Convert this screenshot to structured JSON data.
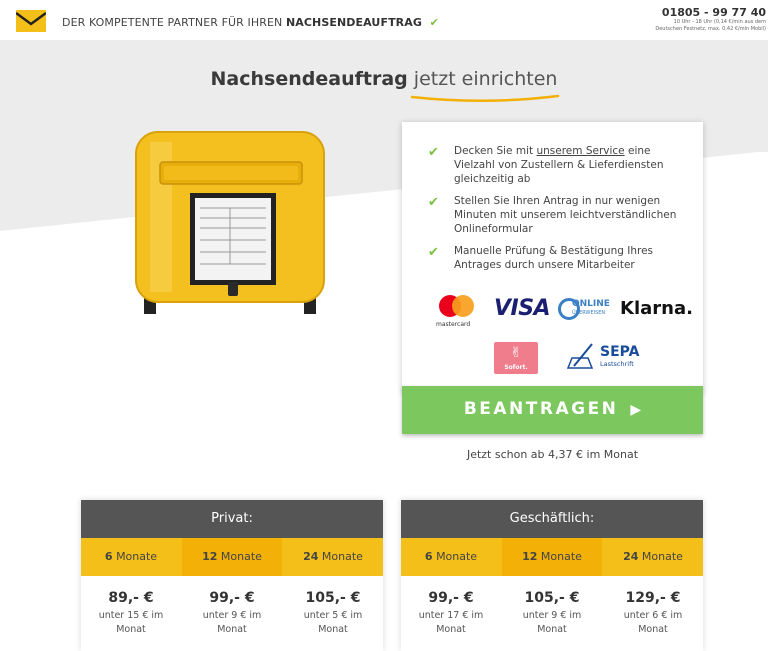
{
  "header": {
    "tagline_prefix": "DER KOMPETENTE PARTNER FÜR IHREN",
    "tagline_bold": "NACHSENDEAUFTRAG",
    "check_icon": "check-icon",
    "phone": "01805 - 99 77 40",
    "phone_note_line1": "10 Uhr - 18 Uhr (0,14 €/min aus dem",
    "phone_note_line2": "Deutschen Festnetz, max. 0,42 €/min Mobil)"
  },
  "hero": {
    "title_bold": "Nachsendeauftrag",
    "title_light": "jetzt einrichten"
  },
  "features": [
    {
      "before": "Decken Sie mit ",
      "link": "unserem Service",
      "after": " eine Vielzahl von Zustellern & Lieferdiensten gleichzeitig ab"
    },
    {
      "before": "Stellen Sie Ihren Antrag in nur wenigen Minuten mit unserem leichtverständlichen Onlineformular",
      "link": "",
      "after": ""
    },
    {
      "before": "Manuelle Prüfung & Bestätigung Ihres Antrages durch unsere Mitarbeiter",
      "link": "",
      "after": ""
    }
  ],
  "payments": {
    "mastercard": "mastercard",
    "visa": "VISA",
    "online_line1": "ONLINE",
    "online_line2": "ÜBERWEISEN",
    "klarna": "Klarna.",
    "sofort": "Sofort.",
    "sepa_line1": "SEPA",
    "sepa_line2": "Lastschrift"
  },
  "cta": {
    "label": "BEANTRAGEN",
    "arrow": "▶",
    "price_note": "Jetzt schon ab 4,37 € im Monat"
  },
  "pricing": {
    "private": {
      "title": "Privat:",
      "durations": [
        {
          "num": "6",
          "unit": "Monate"
        },
        {
          "num": "12",
          "unit": "Monate"
        },
        {
          "num": "24",
          "unit": "Monate"
        }
      ],
      "prices": [
        {
          "amount": "89,- €",
          "sub1": "unter 15 € im",
          "sub2": "Monat"
        },
        {
          "amount": "99,- €",
          "sub1": "unter 9 € im",
          "sub2": "Monat"
        },
        {
          "amount": "105,- €",
          "sub1": "unter 5 € im",
          "sub2": "Monat"
        }
      ]
    },
    "business": {
      "title": "Geschäftlich:",
      "durations": [
        {
          "num": "6",
          "unit": "Monate"
        },
        {
          "num": "12",
          "unit": "Monate"
        },
        {
          "num": "24",
          "unit": "Monate"
        }
      ],
      "prices": [
        {
          "amount": "99,- €",
          "sub1": "unter 17 € im",
          "sub2": "Monat"
        },
        {
          "amount": "105,- €",
          "sub1": "unter 9 € im",
          "sub2": "Monat"
        },
        {
          "amount": "129,- €",
          "sub1": "unter 6 € im",
          "sub2": "Monat"
        }
      ]
    }
  },
  "colors": {
    "accent_green": "#7cc75e",
    "check_green": "#7cc142",
    "brand_yellow": "#f5bf1a",
    "table_header": "#555555"
  }
}
